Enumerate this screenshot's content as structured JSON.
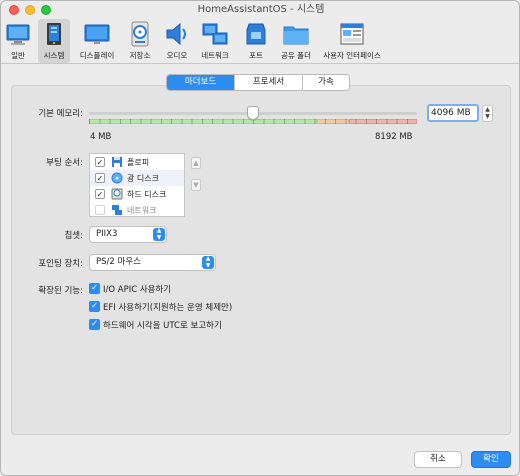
{
  "window": {
    "title": "HomeAssistantOS - 시스템"
  },
  "toolbar": {
    "items": [
      {
        "label": "일반",
        "icon": "general-icon"
      },
      {
        "label": "시스템",
        "icon": "system-icon",
        "selected": true
      },
      {
        "label": "디스플레이",
        "icon": "display-icon"
      },
      {
        "label": "저장소",
        "icon": "storage-icon"
      },
      {
        "label": "오디오",
        "icon": "audio-icon"
      },
      {
        "label": "네트워크",
        "icon": "network-icon"
      },
      {
        "label": "포트",
        "icon": "ports-icon"
      },
      {
        "label": "공유 폴더",
        "icon": "shared-folder-icon"
      },
      {
        "label": "사용자 인터페이스",
        "icon": "user-interface-icon"
      }
    ]
  },
  "tabs": [
    {
      "label": "마더보드",
      "active": true
    },
    {
      "label": "프로세서",
      "active": false
    },
    {
      "label": "가속",
      "active": false
    }
  ],
  "motherboard": {
    "base_memory": {
      "label": "기본 메모리:",
      "value_text": "4096 MB",
      "value_mb": 4096,
      "min_label": "4 MB",
      "max_label": "8192 MB",
      "min_mb": 4,
      "max_mb": 8192
    },
    "boot_order": {
      "label": "부팅 순서:",
      "items": [
        {
          "label": "플로피",
          "checked": true,
          "icon": "floppy-icon"
        },
        {
          "label": "광 디스크",
          "checked": true,
          "icon": "optical-disk-icon"
        },
        {
          "label": "하드 디스크",
          "checked": true,
          "icon": "hard-disk-icon"
        },
        {
          "label": "네트워크",
          "checked": false,
          "icon": "network-boot-icon"
        }
      ],
      "move_up": "▲",
      "move_down": "▼"
    },
    "chipset": {
      "label": "칩셋:",
      "value": "PIIX3"
    },
    "pointing_device": {
      "label": "포인팅 장치:",
      "value": "PS/2 마우스"
    },
    "extended_features": {
      "label": "확장된 기능:",
      "options": [
        {
          "label": "I/O APIC 사용하기",
          "checked": true
        },
        {
          "label": "EFI 사용하기(지원하는 운영 체제만)",
          "checked": true
        },
        {
          "label": "하드웨어 시각을 UTC로 보고하기",
          "checked": true
        }
      ]
    }
  },
  "buttons": {
    "cancel": "취소",
    "ok": "확인"
  },
  "colors": {
    "accent": "#2c8cf0",
    "selected_tab_bg": "#2c8cf0",
    "traffic_close": "#fe5f57",
    "traffic_min": "#febc2e",
    "traffic_max": "#28c840"
  },
  "glyphs": {
    "check": "✓",
    "up": "▲",
    "down": "▼",
    "stepper": "⌃⌄",
    "select_arrow": "▲▼"
  }
}
